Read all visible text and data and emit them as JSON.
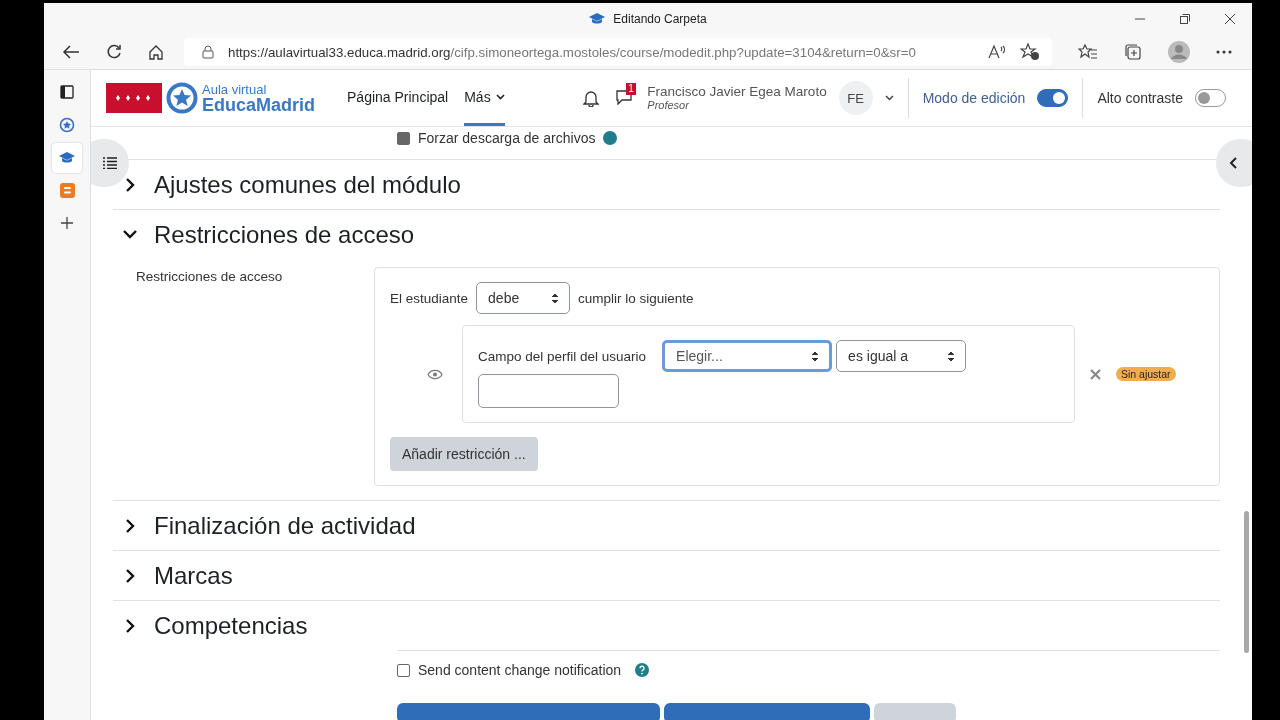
{
  "browser": {
    "tab_title": "Editando Carpeta",
    "url_host": "https://aulavirtual33.educa.madrid.org",
    "url_path": "/cifp.simoneortega.mostoles/course/modedit.php?update=3104&return=0&sr=0"
  },
  "header": {
    "logo_top": "Aula virtual",
    "logo_bottom": "EducaMadrid",
    "nav": [
      {
        "label": "Página Principal",
        "selected": false
      },
      {
        "label": "Más",
        "selected": true
      }
    ],
    "message_count": "1",
    "user_name": "Francisco Javier Egea Maroto",
    "user_role": "Profesor",
    "initials": "FE",
    "edit_mode": {
      "label": "Modo de edición",
      "on": true
    },
    "contrast": {
      "label": "Alto contraste",
      "on": false
    }
  },
  "partial_option": {
    "label": "Forzar descarga de archivos",
    "checked": true
  },
  "sections": [
    {
      "title": "Ajustes comunes del módulo",
      "expanded": false
    },
    {
      "title": "Restricciones de acceso",
      "expanded": true,
      "restrictions": {
        "label": "Restricciones de acceso",
        "prefix": "El estudiante",
        "mode": "debe",
        "suffix": "cumplir lo siguiente",
        "condition_label": "Campo del perfil del usuario",
        "field": "Elegir...",
        "operator": "es igual a",
        "badge": "Sin ajustar",
        "add_button": "Añadir restricción ..."
      }
    },
    {
      "title": "Finalización de actividad",
      "expanded": false
    },
    {
      "title": "Marcas",
      "expanded": false
    },
    {
      "title": "Competencias",
      "expanded": false
    }
  ],
  "notification": {
    "label": "Send content change notification",
    "checked": false
  }
}
